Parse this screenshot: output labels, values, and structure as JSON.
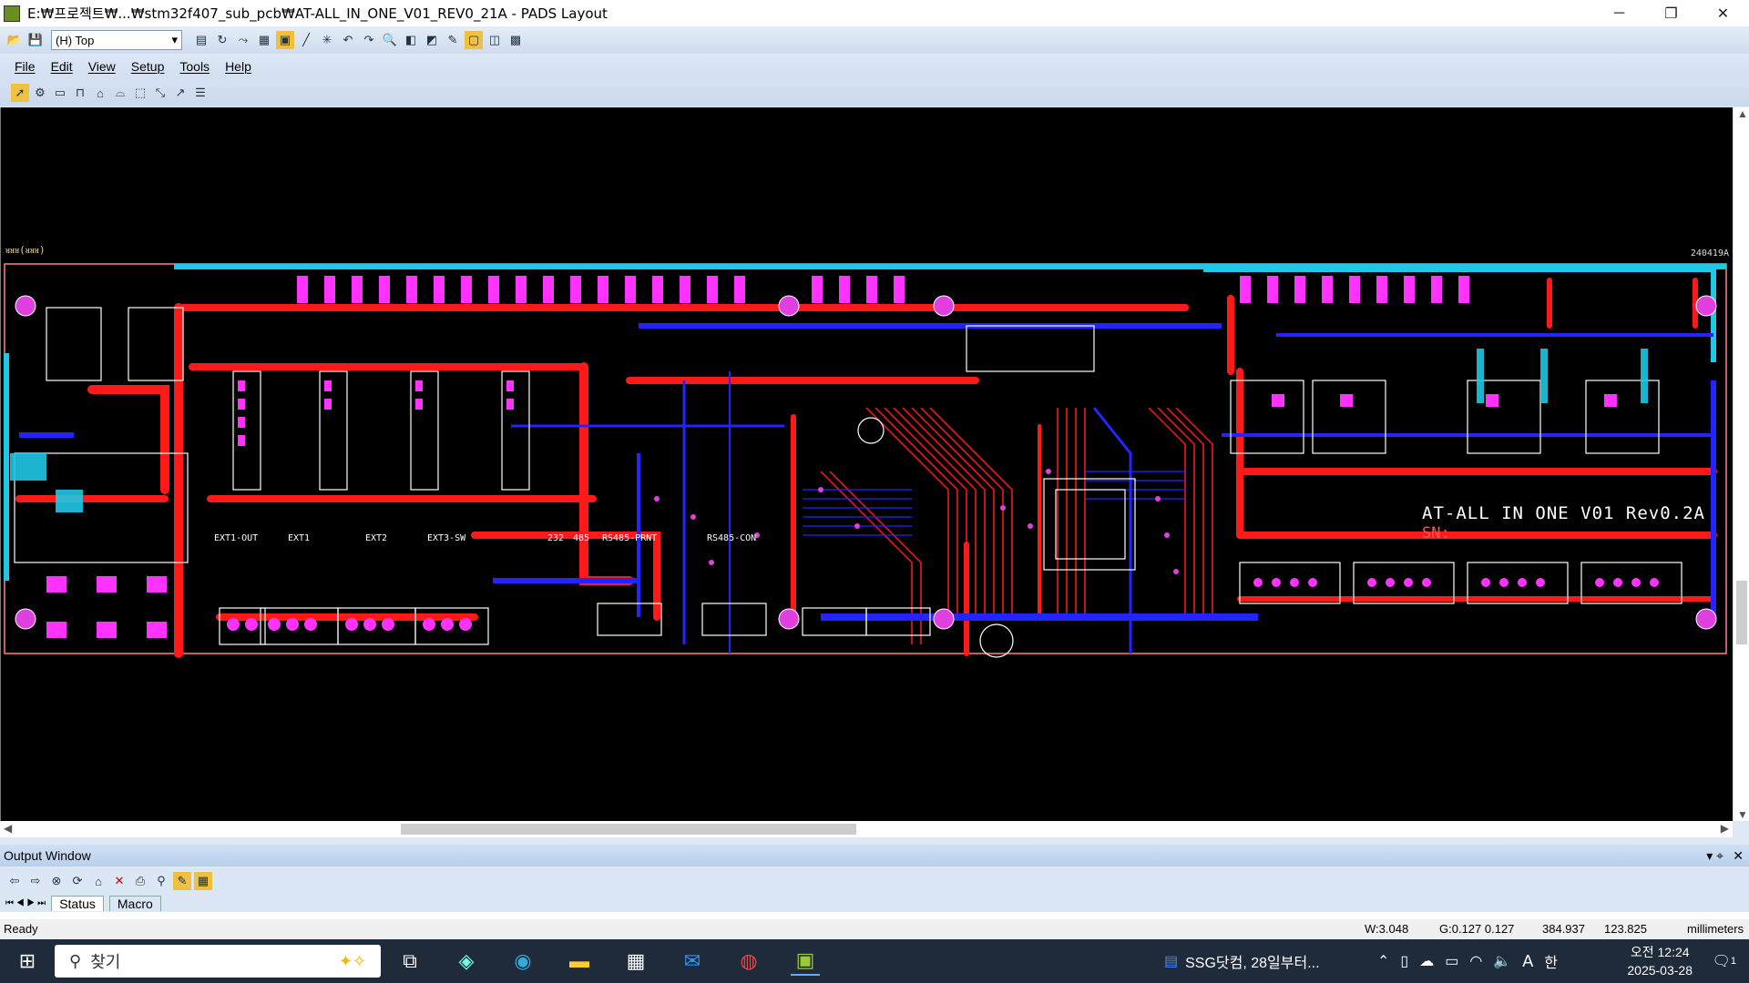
{
  "window": {
    "title": "E:₩프로젝트₩...₩stm32f407_sub_pcb₩AT-ALL_IN_ONE_V01_REV0_21A - PADS Layout",
    "minimize": "─",
    "maximize": "❐",
    "close": "✕"
  },
  "toolbar": {
    "layer_select": "(H) Top"
  },
  "menu": {
    "items": [
      "File",
      "Edit",
      "View",
      "Setup",
      "Tools",
      "Help"
    ]
  },
  "canvas": {
    "top_left_label": "ᴚᴚᴚ(ᴚᴚᴚ)",
    "top_right_label": "240419A",
    "board_title": "AT-ALL IN ONE V01  Rev0.2A",
    "board_sn": "SN:",
    "connector_labels": [
      "EXT1-OUT",
      "EXT1",
      "EXT2",
      "EXT3-SW",
      "232",
      "485",
      "RS485-PRNT",
      "RS485-CON"
    ],
    "colors": {
      "background": "#000000",
      "top_copper": "#ff1a1a",
      "bottom_copper": "#2424ff",
      "silkscreen": "#ffffff",
      "pads": "#ff33ff",
      "board_outline": "#1ec8e6",
      "vias": "#e040e0"
    }
  },
  "output_window": {
    "title": "Output Window",
    "tabs": [
      "Status",
      "Macro"
    ]
  },
  "status": {
    "ready": "Ready",
    "width": "W:3.048",
    "grid": "G:0.127 0.127",
    "x": "384.937",
    "y": "123.825",
    "units": "millimeters"
  },
  "taskbar": {
    "search_placeholder": "찾기",
    "news": "SSG닷컴, 28일부터...",
    "ime": "A",
    "ime2": "한",
    "time": "오전 12:24",
    "date": "2025-03-28",
    "notif": "1"
  }
}
